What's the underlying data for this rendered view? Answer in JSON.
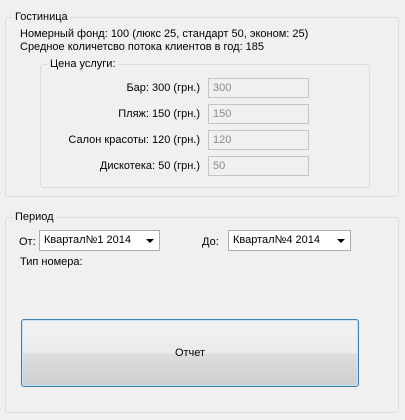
{
  "hotel_group": {
    "title": "Гостиница",
    "rooms_line": "Номерный фонд: 100 (люкс 25, стандарт 50, эконом: 25)",
    "clients_line": "Средное количетсво  потока клиентов в год: 185",
    "services_group": {
      "title": "Цена услуги:",
      "items": [
        {
          "label": "Бар: 300 (грн.)",
          "value": "300"
        },
        {
          "label": "Пляж: 150 (грн.)",
          "value": "150"
        },
        {
          "label": "Салон красоты: 120 (грн.)",
          "value": "120"
        },
        {
          "label": "Дискотека: 50 (грн.)",
          "value": "50"
        }
      ]
    }
  },
  "period_group": {
    "title": "Период",
    "from_label": "От:",
    "from_value": "Квартал№1 2014",
    "to_label": "До:",
    "to_value": "Квартал№4 2014",
    "room_type_label": "Тип номера:"
  },
  "report_button": {
    "label": "Отчет"
  },
  "colors": {
    "window_bg": "#f0f0f0",
    "group_border": "#d5dfe5",
    "button_border": "#3c7fb1",
    "disabled_text": "#8a8a8a"
  },
  "icons": {
    "combo_arrow": "chevron-down-icon"
  }
}
